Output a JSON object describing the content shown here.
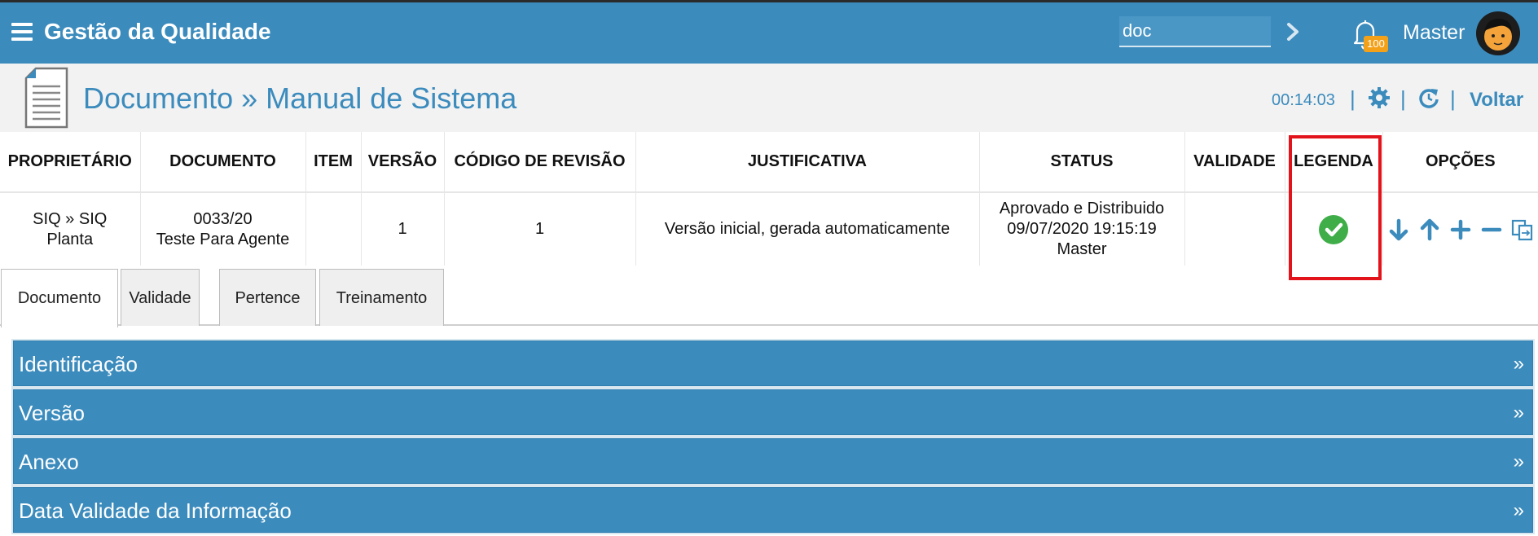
{
  "app": {
    "title": "Gestão da Qualidade"
  },
  "search": {
    "value": "doc"
  },
  "notifications": {
    "count": "100"
  },
  "user": {
    "name": "Master"
  },
  "header": {
    "title": "Documento » Manual de Sistema",
    "timer": "00:14:03",
    "back_label": "Voltar"
  },
  "table": {
    "columns": [
      "PROPRIETÁRIO",
      "DOCUMENTO",
      "ITEM",
      "VERSÃO",
      "CÓDIGO DE REVISÃO",
      "JUSTIFICATIVA",
      "STATUS",
      "VALIDADE",
      "LEGENDA",
      "OPÇÕES"
    ],
    "row": {
      "owner_line1": "SIQ » SIQ",
      "owner_line2": "Planta",
      "document_line1": "0033/20",
      "document_line2": "Teste Para Agente",
      "item": "",
      "version": "1",
      "revision_code": "1",
      "justification": "Versão inicial, gerada automaticamente",
      "status_line1": "Aprovado e Distribuido",
      "status_line2": "09/07/2020 19:15:19",
      "status_line3": "Master",
      "validity": ""
    }
  },
  "tabs": [
    {
      "label": "Documento",
      "active": true
    },
    {
      "label": "Validade",
      "active": false
    },
    {
      "label": "Pertence",
      "active": false
    },
    {
      "label": "Treinamento",
      "active": false
    }
  ],
  "sections": [
    {
      "label": "Identificação",
      "chevron": "»"
    },
    {
      "label": "Versão",
      "chevron": "»"
    },
    {
      "label": "Anexo",
      "chevron": "»"
    },
    {
      "label": "Data Validade da Informação",
      "chevron": "»"
    }
  ],
  "colors": {
    "primary": "#3b8bbd",
    "badge": "#f4a11a",
    "approved": "#3fae49",
    "highlight": "#e3131b"
  },
  "icons": {
    "legend": "check-circle-icon",
    "options": [
      "arrow-down-icon",
      "arrow-up-icon",
      "plus-icon",
      "minus-icon",
      "copy-icon"
    ]
  }
}
